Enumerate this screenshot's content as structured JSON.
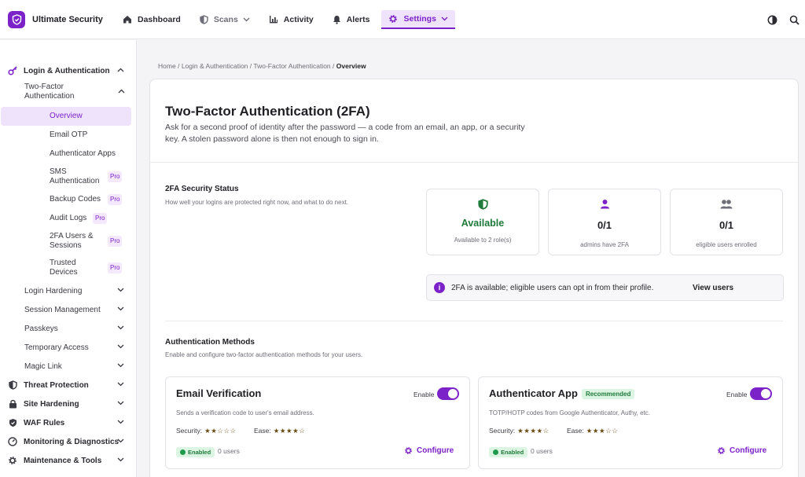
{
  "brand": {
    "name": "Ultimate Security"
  },
  "nav": {
    "dashboard": "Dashboard",
    "scans": "Scans",
    "activity": "Activity",
    "alerts": "Alerts",
    "settings": "Settings"
  },
  "sidebar": {
    "login_auth": "Login & Authentication",
    "two_factor": "Two-Factor Authentication",
    "tf_items": [
      {
        "label": "Overview"
      },
      {
        "label": "Email OTP"
      },
      {
        "label": "Authenticator Apps"
      },
      {
        "label": "SMS Authentication",
        "pro": "Pro"
      },
      {
        "label": "Backup Codes",
        "pro": "Pro"
      },
      {
        "label": "Audit Logs",
        "pro": "Pro"
      },
      {
        "label": "2FA Users & Sessions",
        "pro": "Pro"
      },
      {
        "label": "Trusted Devices",
        "pro": "Pro"
      }
    ],
    "l2_items": [
      "Login Hardening",
      "Session Management",
      "Passkeys",
      "Temporary Access",
      "Magic Link"
    ],
    "l1_items": [
      "Threat Protection",
      "Site Hardening",
      "WAF Rules",
      "Monitoring & Diagnostics",
      "Maintenance & Tools"
    ]
  },
  "breadcrumb": {
    "home": "Home",
    "sep": "/",
    "login_auth": "Login & Authentication",
    "two_factor": "Two-Factor Authentication",
    "current": "Overview"
  },
  "page": {
    "title": "Two-Factor Authentication (2FA)",
    "description": "Ask for a second proof of identity after the password — a code from an email, an app, or a security key. A stolen password alone is then not enough to sign in."
  },
  "status": {
    "title": "2FA Security Status",
    "subtitle": "How well your logins are protected right now, and what to do next.",
    "cards": [
      {
        "value": "Available",
        "label": "Available to 2 role(s)"
      },
      {
        "value": "0/1",
        "label": "admins have 2FA"
      },
      {
        "value": "0/1",
        "label": "eligible users enrolled"
      }
    ],
    "info_text": "2FA is available; eligible users can opt in from their profile.",
    "view_users": "View users"
  },
  "methods": {
    "title": "Authentication Methods",
    "subtitle": "Enable and configure two-factor authentication methods for your users.",
    "enable_label": "Enable",
    "security_label": "Security:",
    "ease_label": "Ease:",
    "enabled_badge": "Enabled",
    "configure_label": "Configure",
    "items": [
      {
        "name": "Email Verification",
        "desc": "Sends a verification code to user's email address.",
        "security_stars": "★★☆☆☆",
        "ease_stars": "★★★★☆",
        "users": "0 users",
        "security_rating": 2,
        "ease_rating": 4
      },
      {
        "name": "Authenticator App",
        "badge": "Recommended",
        "desc": "TOTP/HOTP codes from Google Authenticator, Authy, etc.",
        "security_stars": "★★★★☆",
        "ease_stars": "★★★☆☆",
        "users": "0 users",
        "security_rating": 4,
        "ease_rating": 3
      }
    ]
  },
  "colors": {
    "accent": "#7c22c9",
    "accent_light": "#efe3fb",
    "success": "#1f7a3a",
    "success_bg": "#dcf5e3"
  },
  "icons": [
    "shield-logo-icon",
    "home-icon",
    "shield-icon",
    "chevron-down-icon",
    "bar-chart-icon",
    "bell-icon",
    "gear-icon",
    "theme-toggle-icon",
    "search-icon",
    "key-icon",
    "lock-icon",
    "gauge-icon",
    "user-icon",
    "users-icon",
    "info-icon"
  ]
}
